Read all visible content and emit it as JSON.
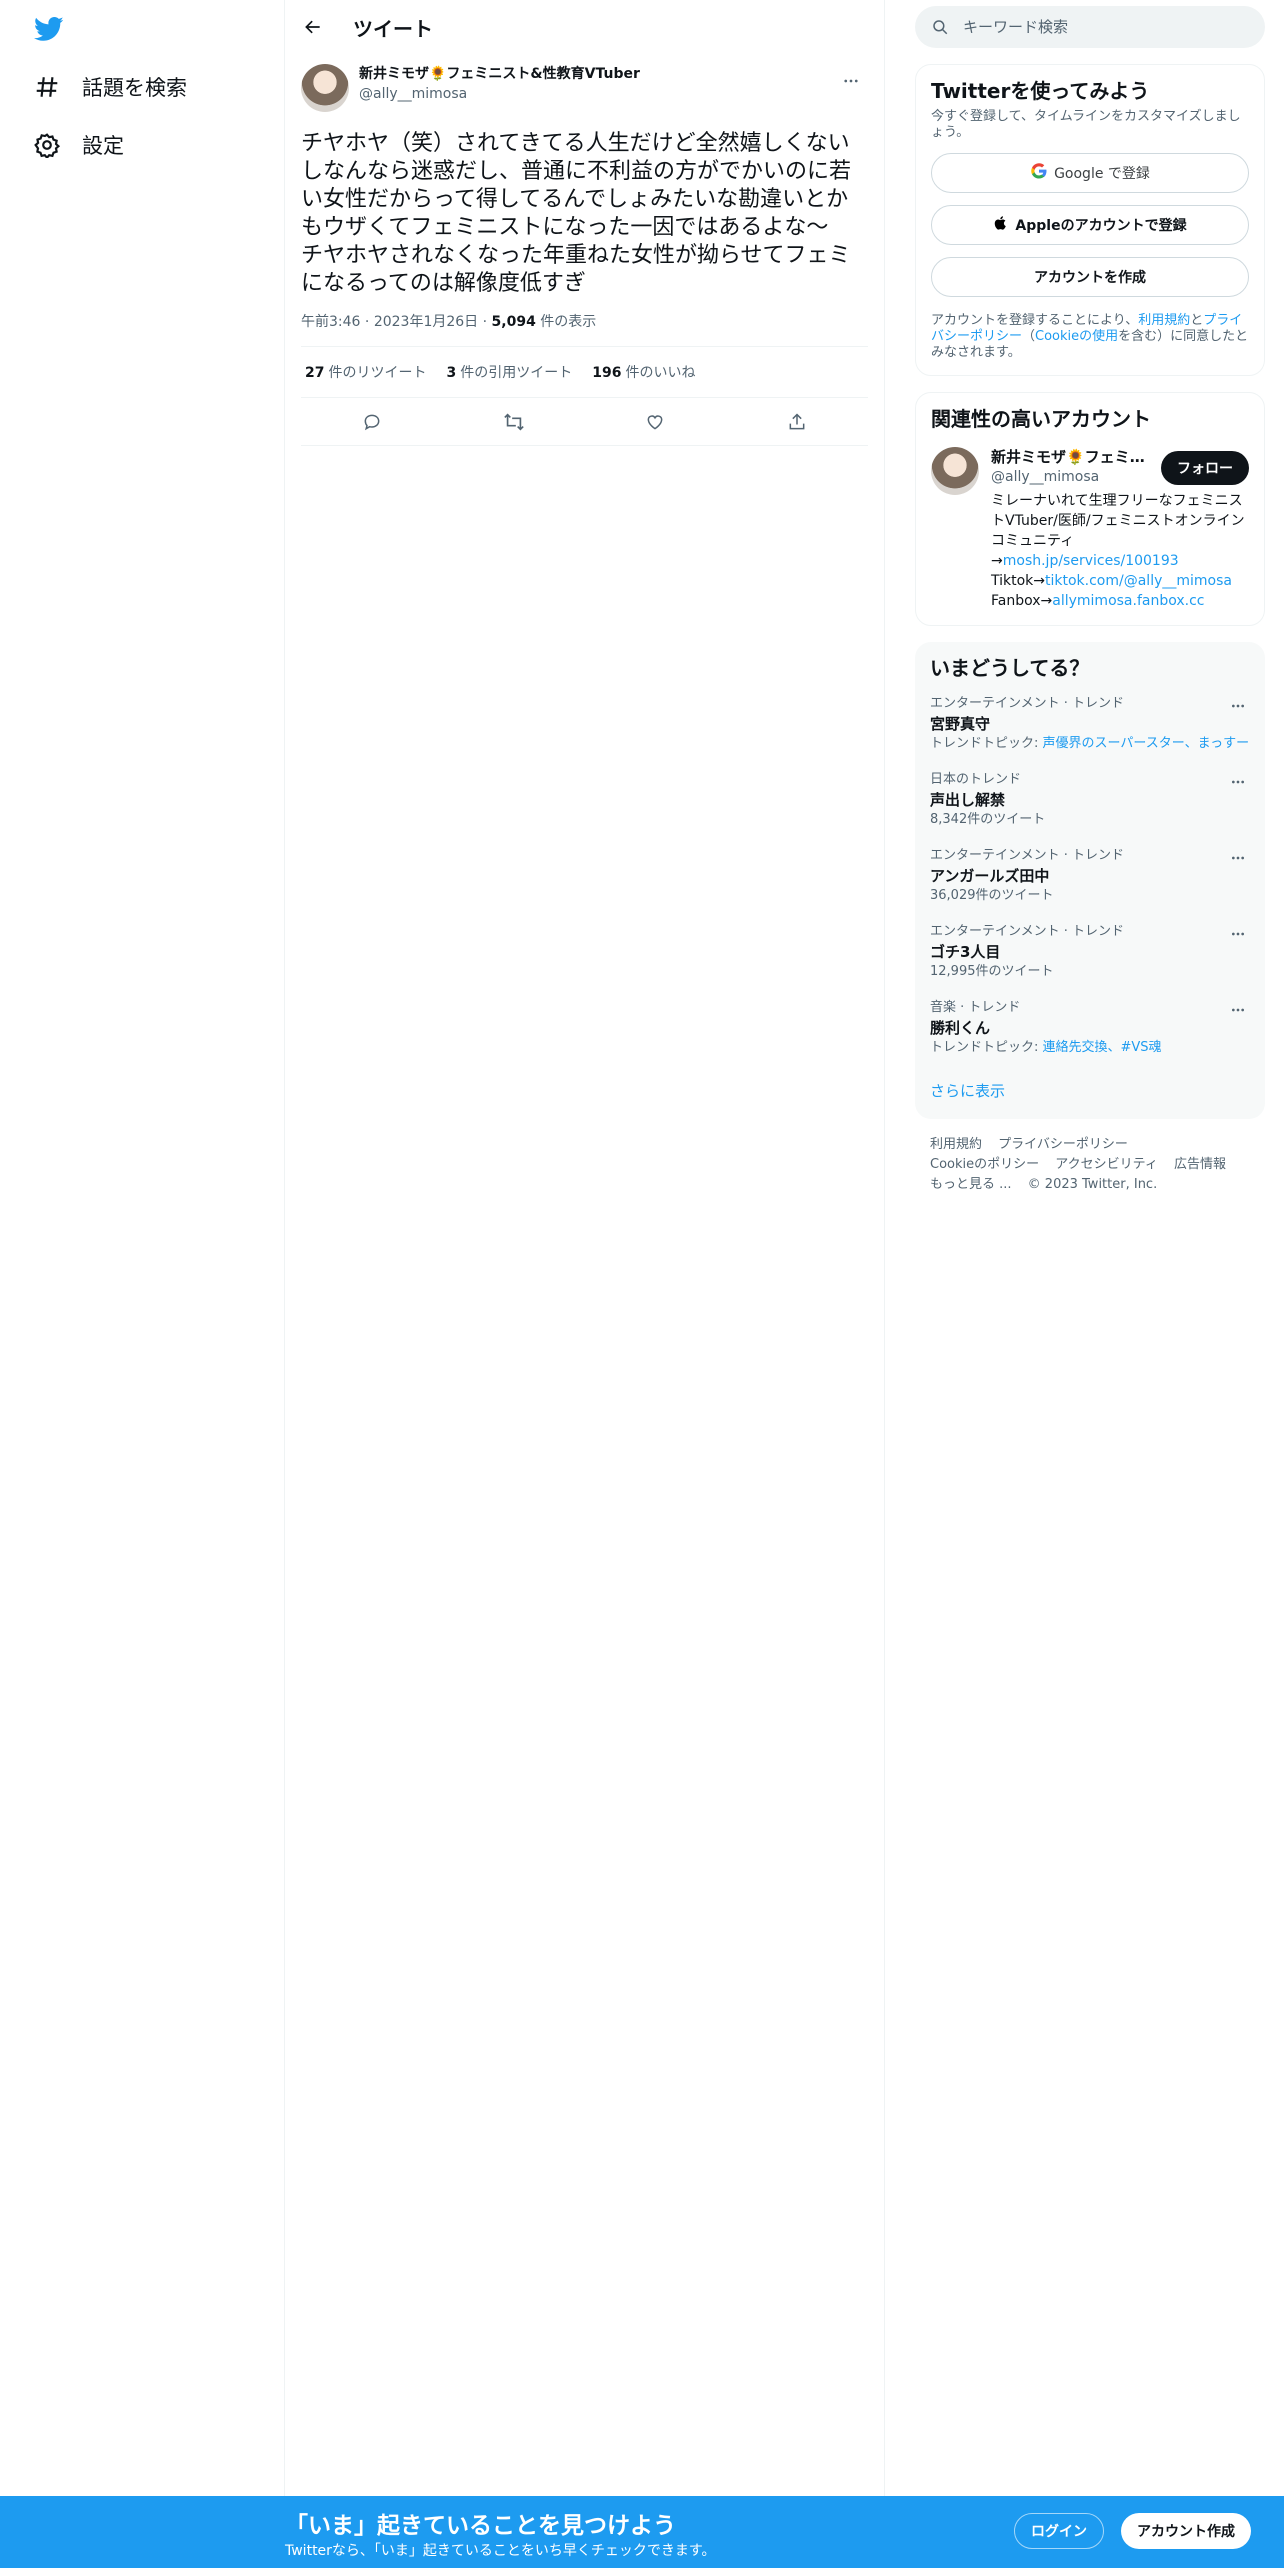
{
  "nav": {
    "logo_icon": "twitter-bird-icon",
    "items": [
      {
        "icon": "hashtag-icon",
        "label": "話題を検索"
      },
      {
        "icon": "gear-icon",
        "label": "設定"
      }
    ]
  },
  "header": {
    "title": "ツイート"
  },
  "tweet": {
    "author_name": "新井ミモザ🌻フェミニスト&性教育VTuber",
    "author_handle": "@ally__mimosa",
    "text": "チヤホヤ（笑）されてきてる人生だけど全然嬉しくないしなんなら迷惑だし、普通に不利益の方がでかいのに若い女性だからって得してるんでしょみたいな勘違いとかもウザくてフェミニストになった一因ではあるよな〜　チヤホヤされなくなった年重ねた女性が拗らせてフェミになるってのは解像度低すぎ",
    "time": "午前3:46",
    "date": "2023年1月26日",
    "views_count": "5,094",
    "views_label": "件の表示",
    "retweets_count": "27",
    "retweets_label": "件のリツイート",
    "quotes_count": "3",
    "quotes_label": "件の引用ツイート",
    "likes_count": "196",
    "likes_label": "件のいいね"
  },
  "search": {
    "placeholder": "キーワード検索"
  },
  "signup": {
    "title": "Twitterを使ってみよう",
    "desc": "今すぐ登録して、タイムラインをカスタマイズしましょう。",
    "google_label": "Google で登録",
    "apple_label": "Appleのアカウントで登録",
    "create_label": "アカウントを作成",
    "legal_pre": "アカウントを登録することにより、",
    "legal_terms": "利用規約",
    "legal_and": "と",
    "legal_privacy": "プライバシーポリシー",
    "legal_paren_open": "（",
    "legal_cookie": "Cookieの使用",
    "legal_post": "を含む）に同意したとみなされます。"
  },
  "related": {
    "title": "関連性の高いアカウント",
    "name": "新井ミモザ🌻フェミニスト&性教育VTuber",
    "handle": "@ally__mimosa",
    "follow_label": "フォロー",
    "bio_1": "ミレーナいれて生理フリーなフェミニストVTuber/医師/フェミニストオンラインコミュニティ→",
    "bio_link1": "mosh.jp/services/100193",
    "bio_2": " Tiktok→",
    "bio_link2": "tiktok.com/@ally__mimosa",
    "bio_3": " Fanbox→",
    "bio_link3": "allymimosa.fanbox.cc"
  },
  "trends": {
    "title": "いまどうしてる？",
    "items": [
      {
        "context": "エンターテインメント · トレンド",
        "name": "宮野真守",
        "sub_label": "トレンドトピック: ",
        "sub_links": "声優界のスーパースター、まっすー"
      },
      {
        "context": "日本のトレンド",
        "name": "声出し解禁",
        "sub_label": "8,342件のツイート",
        "sub_links": ""
      },
      {
        "context": "エンターテインメント · トレンド",
        "name": "アンガールズ田中",
        "sub_label": "36,029件のツイート",
        "sub_links": ""
      },
      {
        "context": "エンターテインメント · トレンド",
        "name": "ゴチ3人目",
        "sub_label": "12,995件のツイート",
        "sub_links": ""
      },
      {
        "context": "音楽 · トレンド",
        "name": "勝利くん",
        "sub_label": "トレンドトピック: ",
        "sub_links": "連絡先交換、#VS魂"
      }
    ],
    "show_more": "さらに表示"
  },
  "footer": {
    "links": [
      "利用規約",
      "プライバシーポリシー",
      "Cookieのポリシー",
      "アクセシビリティ",
      "広告情報",
      "もっと見る ..."
    ],
    "copyright": "© 2023 Twitter, Inc."
  },
  "bottombar": {
    "title": "「いま」起きていることを見つけよう",
    "sub": "Twitterなら、「いま」起きていることをいち早くチェックできます。",
    "login_label": "ログイン",
    "signup_label": "アカウント作成"
  },
  "colors": {
    "accent": "#1d9bf0",
    "text": "#0f1419",
    "muted": "#536471",
    "border": "#eff3f4"
  }
}
